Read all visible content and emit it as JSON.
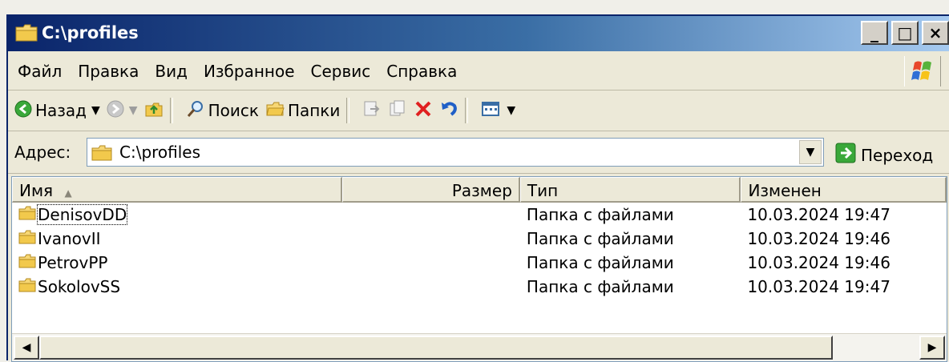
{
  "window": {
    "title": "C:\\profiles",
    "buttons": {
      "minimize": "_",
      "maximize": "□",
      "close": "×"
    }
  },
  "menu": [
    {
      "label": "Файл"
    },
    {
      "label": "Правка"
    },
    {
      "label": "Вид"
    },
    {
      "label": "Избранное"
    },
    {
      "label": "Сервис"
    },
    {
      "label": "Справка"
    }
  ],
  "toolbar": {
    "back_label": "Назад",
    "search_label": "Поиск",
    "folders_label": "Папки"
  },
  "address": {
    "label": "Адрес:",
    "value": "C:\\profiles",
    "go_label": "Переход"
  },
  "columns": {
    "name": "Имя",
    "size": "Размер",
    "type": "Тип",
    "modified": "Изменен"
  },
  "files": [
    {
      "name": "DenisovDD",
      "size": "",
      "type": "Папка с файлами",
      "modified": "10.03.2024 19:47"
    },
    {
      "name": "IvanovII",
      "size": "",
      "type": "Папка с файлами",
      "modified": "10.03.2024 19:46"
    },
    {
      "name": "PetrovPP",
      "size": "",
      "type": "Папка с файлами",
      "modified": "10.03.2024 19:46"
    },
    {
      "name": "SokolovSS",
      "size": "",
      "type": "Папка с файлами",
      "modified": "10.03.2024 19:47"
    }
  ],
  "colors": {
    "title_start": "#0a246a",
    "title_end": "#a6caf0",
    "chrome": "#ece9d8",
    "folder": "#f2c94c"
  },
  "icons": {
    "title": "folder-icon",
    "back": "back-arrow-icon",
    "forward": "forward-arrow-icon",
    "up": "up-folder-icon",
    "search": "search-icon",
    "folders": "folders-icon",
    "move": "move-to-icon",
    "copy": "copy-to-icon",
    "delete": "delete-icon",
    "undo": "undo-icon",
    "views": "views-icon",
    "go": "go-arrow-icon",
    "logo": "windows-logo-icon"
  }
}
